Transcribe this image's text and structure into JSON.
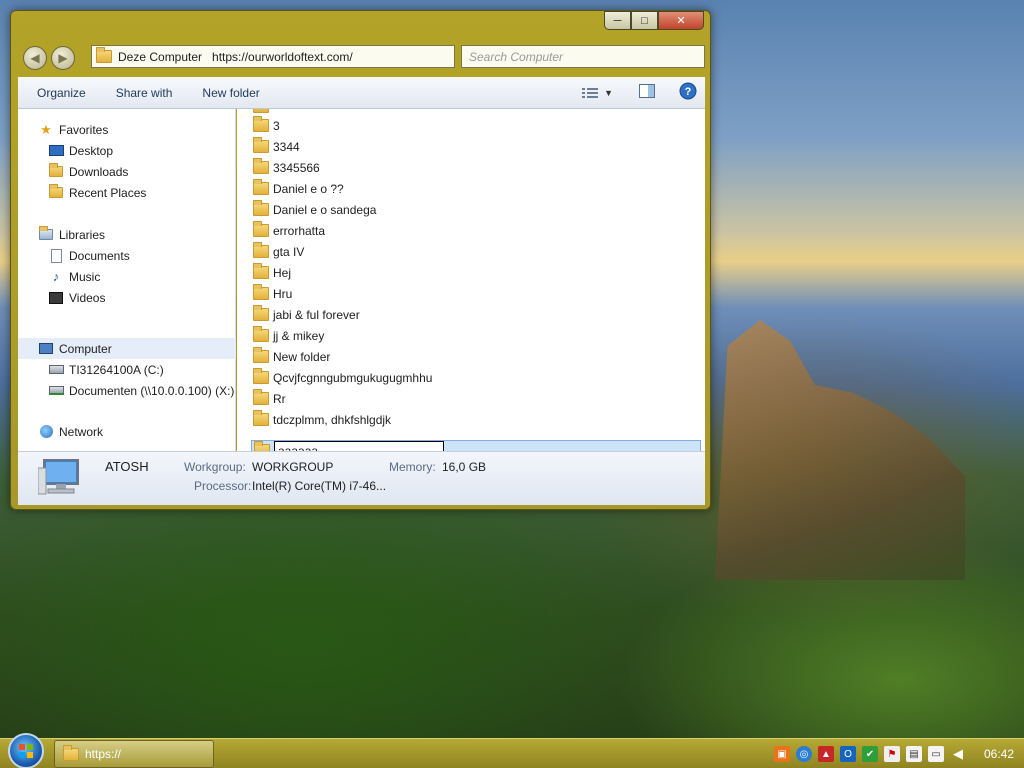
{
  "window": {
    "address": "Deze Computer   https://ourworldoftext.com/",
    "search_placeholder": "Search Computer",
    "caption_minimize": "─",
    "caption_maximize": "□",
    "caption_close": "✕"
  },
  "toolbar": {
    "organize": "Organize",
    "share_with": "Share with",
    "new_folder": "New folder"
  },
  "navigation": {
    "favorites": "Favorites",
    "favorites_items": [
      "Desktop",
      "Downloads",
      "Recent Places"
    ],
    "libraries": "Libraries",
    "libraries_items": [
      "Documents",
      "Music",
      "Videos"
    ],
    "computer": "Computer",
    "computer_items": [
      "TI31264100A (C:)",
      "Documenten (\\\\10.0.0.100) (X:)"
    ],
    "network": "Network"
  },
  "folders": [
    "3",
    "3344",
    "3345566",
    "Daniel e o ??",
    "Daniel e o sandega",
    "errorhatta",
    "gta IV",
    "Hej",
    "Hru",
    "jabi & ful forever",
    "jj & mikey",
    "New folder",
    "Qcvjfcgnngubmgukugugmhhu",
    "Rr",
    "tdczplmm, dhkfshlgdjk"
  ],
  "rename": {
    "value": "aaaaaa"
  },
  "details": {
    "computer_name": "ATOSH",
    "workgroup_label": "Workgroup:",
    "workgroup_value": "WORKGROUP",
    "memory_label": "Memory:",
    "memory_value": "16,0 GB",
    "processor_label": "Processor:",
    "processor_value": "Intel(R) Core(TM) i7-46..."
  },
  "taskbar": {
    "active_window": "https://",
    "clock": "06:42"
  },
  "colors": {
    "window_frame": "#b3a328",
    "selection": "#cce4f7",
    "toolbar_text": "#1e395b"
  }
}
